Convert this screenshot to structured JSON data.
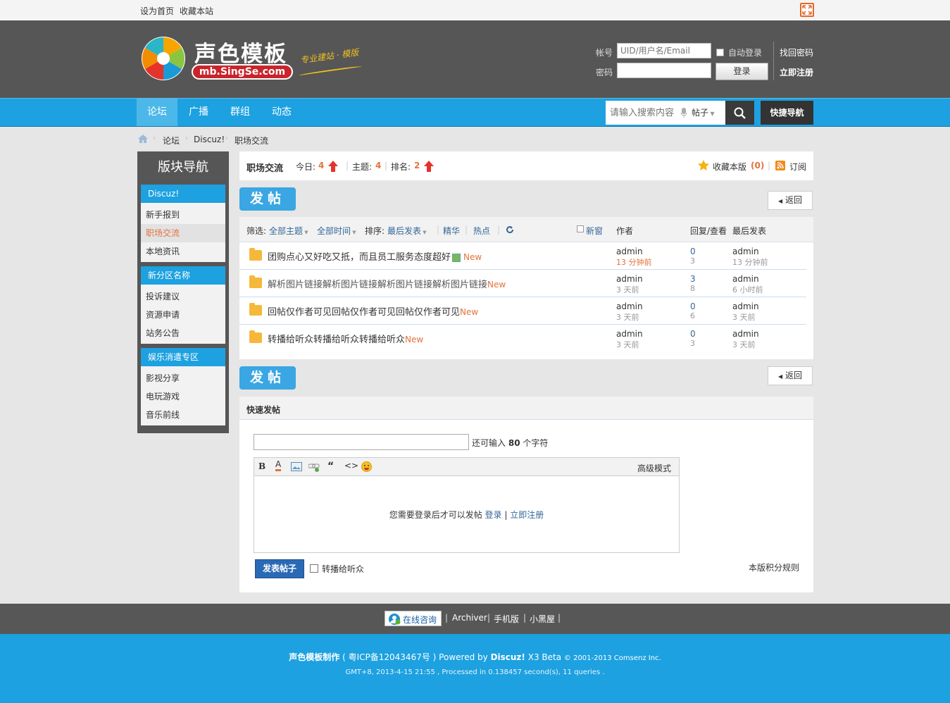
{
  "topbar": {
    "set_home": "设为首页",
    "bookmark": "收藏本站"
  },
  "header": {
    "logo_cn": "声色模板",
    "logo_url": "mb.SingSe.com",
    "logo_slogan": "专业建站 · 模版",
    "login": {
      "account_label": "帐号",
      "account_placeholder": "UID/用户名/Email",
      "password_label": "密码",
      "auto_login": "自动登录",
      "login_button": "登录",
      "find_password": "找回密码",
      "register": "立即注册"
    }
  },
  "nav": {
    "items": [
      {
        "label": "论坛"
      },
      {
        "label": "广播"
      },
      {
        "label": "群组"
      },
      {
        "label": "动态"
      }
    ],
    "search_placeholder": "请输入搜索内容",
    "search_type": "帖子",
    "quick_nav": "快捷导航"
  },
  "breadcrumb": {
    "items": [
      "论坛",
      "Discuz!",
      "职场交流"
    ]
  },
  "sidebar": {
    "title": "版块导航",
    "groups": [
      {
        "head": "Discuz!",
        "items": [
          "新手报到",
          "职场交流",
          "本地资讯"
        ]
      },
      {
        "head": "新分区名称",
        "items": [
          "投诉建议",
          "资源申请",
          "站务公告"
        ]
      },
      {
        "head": "娱乐消遣专区",
        "items": [
          "影视分享",
          "电玩游戏",
          "音乐前线"
        ]
      }
    ]
  },
  "forum": {
    "name": "职场交流",
    "today_label": "今日:",
    "today": "4",
    "topics_label": "主题:",
    "topics": "4",
    "rank_label": "排名:",
    "rank": "2",
    "favorite_label": "收藏本版",
    "favorite_count": "(0)",
    "subscribe": "订阅"
  },
  "actions": {
    "post": "发帖",
    "back": "返回"
  },
  "filter": {
    "label": "筛选:",
    "all_topics": "全部主题",
    "all_time": "全部时间",
    "sort_label": "排序:",
    "sort_value": "最后发表",
    "digest": "精华",
    "hot": "热点",
    "new_window": "新窗",
    "col_author": "作者",
    "col_replies": "回复/查看",
    "col_last": "最后发表"
  },
  "threads": [
    {
      "title": "团购点心又好吃又抵，而且员工服务态度超好",
      "tag": "New",
      "author": "admin",
      "author_time": "13 分钟前",
      "replies": "0",
      "views": "3",
      "last_user": "admin",
      "last_time": "13 分钟前"
    },
    {
      "title": "解析图片链接解析图片链接解析图片链接解析图片链接",
      "tag": "New",
      "author": "admin",
      "author_time": "3 天前",
      "replies": "3",
      "views": "8",
      "last_user": "admin",
      "last_time": "6 小时前"
    },
    {
      "title": "回帖仅作者可见回帖仅作者可见回帖仅作者可见",
      "tag": "New",
      "author": "admin",
      "author_time": "3 天前",
      "replies": "0",
      "views": "6",
      "last_user": "admin",
      "last_time": "3 天前"
    },
    {
      "title": "转播给听众转播给听众转播给听众",
      "tag": "New",
      "author": "admin",
      "author_time": "3 天前",
      "replies": "0",
      "views": "3",
      "last_user": "admin",
      "last_time": "3 天前"
    }
  ],
  "quick_post": {
    "title": "快速发帖",
    "remaining_prefix": "还可输入",
    "remaining_count": "80",
    "remaining_suffix": "个字符",
    "advanced_mode": "高级模式",
    "login_notice": "您需要登录后才可以发帖",
    "login_link": "登录",
    "separator": "|",
    "register_link": "立即注册",
    "submit": "发表帖子",
    "forward_label": "转播给听众",
    "credit_rules": "本版积分规则"
  },
  "footer": {
    "online_consult": "在线咨询",
    "links": [
      "Archiver",
      "手机版",
      "小黑屋"
    ],
    "copyright_brand": "声色模板制作",
    "icp": "( 粤ICP备12043467号 )",
    "powered_by": "Powered by",
    "discuz": "Discuz!",
    "version": "X3 Beta",
    "copyright_years": "© 2001-2013 Comsenz Inc.",
    "process_info": "GMT+8, 2013-4-15 21:55 , Processed in 0.138457 second(s), 11 queries ."
  },
  "colors": {
    "accent": "#1da1e0",
    "header_bg": "#565656",
    "new_tag": "#e3733b",
    "link": "#336699"
  },
  "icons": [
    "fullscreen-icon",
    "home-icon",
    "arrow-up-icon",
    "star-icon",
    "rss-icon",
    "refresh-icon",
    "search-icon",
    "microphone-icon",
    "folder-icon",
    "bold-icon",
    "font-color-icon",
    "image-icon",
    "link-icon",
    "quote-icon",
    "code-icon",
    "smiley-icon"
  ]
}
